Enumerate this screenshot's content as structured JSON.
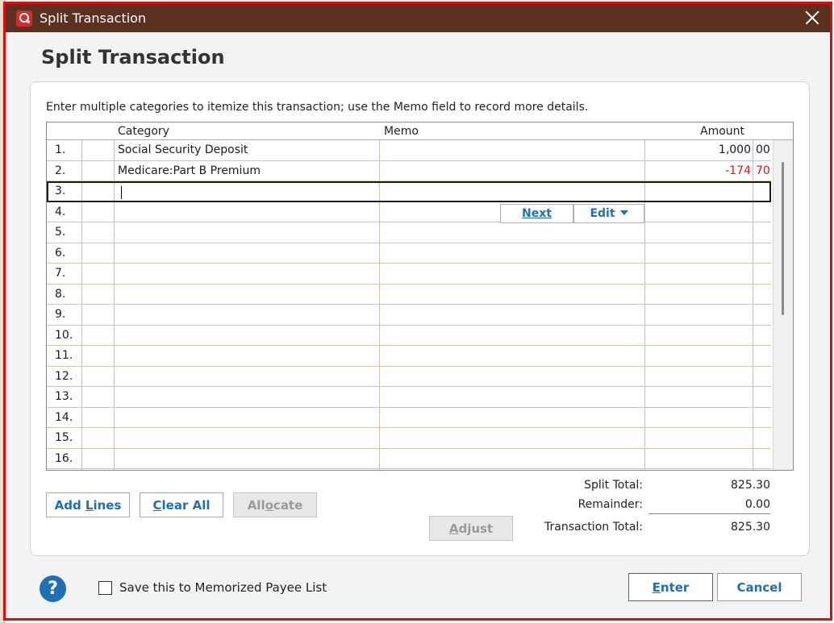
{
  "window": {
    "title": "Split Transaction",
    "heading": "Split Transaction"
  },
  "instruction": "Enter multiple categories to itemize this transaction; use the Memo field to record more details.",
  "grid": {
    "headers": {
      "category": "Category",
      "memo": "Memo",
      "amount": "Amount"
    },
    "rows": [
      {
        "num": "1.",
        "category": "Social Security Deposit",
        "memo": "",
        "amount_int": "1,000",
        "amount_dec": "00",
        "negative": false
      },
      {
        "num": "2.",
        "category": "Medicare:Part B Premium",
        "memo": "",
        "amount_int": "-174",
        "amount_dec": "70",
        "negative": true
      },
      {
        "num": "3.",
        "category": "",
        "memo": "",
        "amount_int": "",
        "amount_dec": ""
      },
      {
        "num": "4.",
        "category": "",
        "memo": "",
        "amount_int": "",
        "amount_dec": ""
      },
      {
        "num": "5.",
        "category": "",
        "memo": "",
        "amount_int": "",
        "amount_dec": ""
      },
      {
        "num": "6.",
        "category": "",
        "memo": "",
        "amount_int": "",
        "amount_dec": ""
      },
      {
        "num": "7.",
        "category": "",
        "memo": "",
        "amount_int": "",
        "amount_dec": ""
      },
      {
        "num": "8.",
        "category": "",
        "memo": "",
        "amount_int": "",
        "amount_dec": ""
      },
      {
        "num": "9.",
        "category": "",
        "memo": "",
        "amount_int": "",
        "amount_dec": ""
      },
      {
        "num": "10.",
        "category": "",
        "memo": "",
        "amount_int": "",
        "amount_dec": ""
      },
      {
        "num": "11.",
        "category": "",
        "memo": "",
        "amount_int": "",
        "amount_dec": ""
      },
      {
        "num": "12.",
        "category": "",
        "memo": "",
        "amount_int": "",
        "amount_dec": ""
      },
      {
        "num": "13.",
        "category": "",
        "memo": "",
        "amount_int": "",
        "amount_dec": ""
      },
      {
        "num": "14.",
        "category": "",
        "memo": "",
        "amount_int": "",
        "amount_dec": ""
      },
      {
        "num": "15.",
        "category": "",
        "memo": "",
        "amount_int": "",
        "amount_dec": ""
      },
      {
        "num": "16.",
        "category": "",
        "memo": "",
        "amount_int": "",
        "amount_dec": ""
      }
    ],
    "selected_row": "3.",
    "row_buttons": {
      "next": "Next",
      "edit": "Edit"
    }
  },
  "buttons": {
    "add_lines": "Add Lines",
    "clear_all": "Clear All",
    "allocate": "Allocate",
    "adjust": "Adjust",
    "enter": "Enter",
    "cancel": "Cancel"
  },
  "totals": {
    "split_total_label": "Split Total:",
    "split_total": "825.30",
    "remainder_label": "Remainder:",
    "remainder": "0.00",
    "transaction_total_label": "Transaction Total:",
    "transaction_total": "825.30"
  },
  "footer": {
    "help": "?",
    "memorize_label": "Save this to Memorized Payee List",
    "memorize_checked": false
  },
  "colors": {
    "titlebar": "#5a3020",
    "accent": "#1f6fb5",
    "negative": "#e01515",
    "window_border": "#e30a0a"
  }
}
